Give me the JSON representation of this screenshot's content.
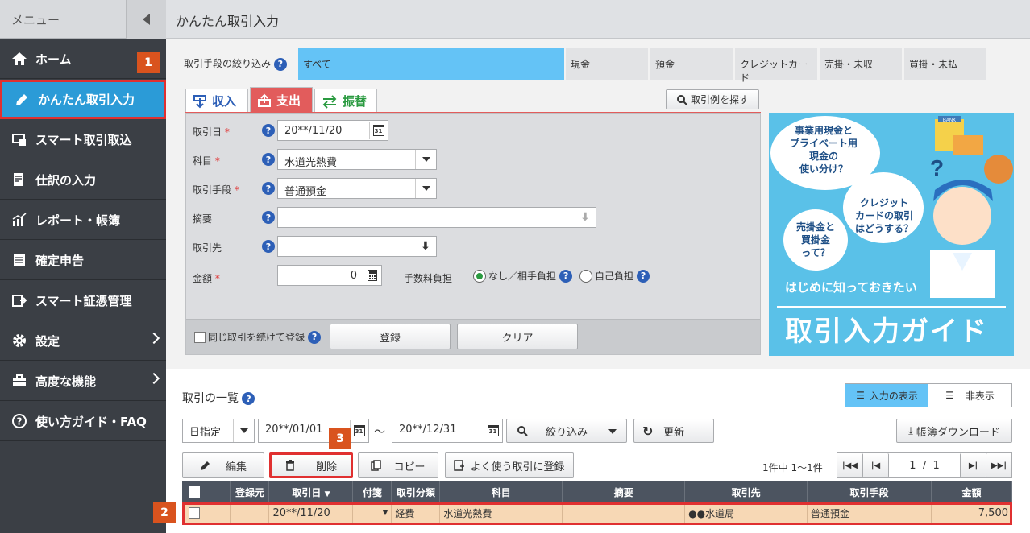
{
  "sidebar": {
    "title": "メニュー",
    "items": [
      {
        "label": "ホーム",
        "icon": "home-icon"
      },
      {
        "label": "かんたん取引入力",
        "icon": "pencil-icon"
      },
      {
        "label": "スマート取引取込",
        "icon": "import-icon"
      },
      {
        "label": "仕訳の入力",
        "icon": "journal-icon"
      },
      {
        "label": "レポート・帳簿",
        "icon": "chart-icon"
      },
      {
        "label": "確定申告",
        "icon": "tax-icon"
      },
      {
        "label": "スマート証憑管理",
        "icon": "receipt-icon"
      },
      {
        "label": "設定",
        "icon": "gear-icon"
      },
      {
        "label": "高度な機能",
        "icon": "toolbox-icon"
      },
      {
        "label": "使い方ガイド・FAQ",
        "icon": "help-icon"
      }
    ]
  },
  "header": {
    "title": "かんたん取引入力"
  },
  "badges": {
    "b1": "1",
    "b2": "2",
    "b3": "3"
  },
  "filter": {
    "label": "取引手段の絞り込み",
    "tabs": [
      "すべて",
      "現金",
      "預金",
      "クレジットカード",
      "売掛・未収",
      "買掛・未払"
    ]
  },
  "type_tabs": {
    "income": "収入",
    "expense": "支出",
    "transfer": "振替"
  },
  "search_example": "取引例を探す",
  "form": {
    "date_label": "取引日",
    "date_value": "20**/11/20",
    "account_label": "科目",
    "account_value": "水道光熱費",
    "method_label": "取引手段",
    "method_value": "普通預金",
    "memo_label": "摘要",
    "partner_label": "取引先",
    "amount_label": "金額",
    "amount_value": "0",
    "fee_label": "手数料負担",
    "fee_none": "なし／相手負担",
    "fee_self": "自己負担",
    "repeat_label": "同じ取引を続けて登録",
    "register": "登録",
    "clear": "クリア"
  },
  "ad": {
    "bubble1": "事業用現金と\nプライベート用\n現金の\n使い分け？",
    "bubble2": "クレジット\nカードの取引\nはどうする？",
    "bubble3": "売掛金と\n買掛金\nって？",
    "sub": "はじめに知っておきたい",
    "main": "取引入力ガイド",
    "bank": "BANK"
  },
  "list": {
    "title": "取引の一覧",
    "show_input": "入力の表示",
    "hide": "非表示",
    "period_mode": "日指定",
    "from": "20**/01/01",
    "tilde": "～",
    "to": "20**/12/31",
    "filter_btn": "絞り込み",
    "refresh": "更新",
    "download": "帳簿ダウンロード",
    "edit": "編集",
    "delete": "削除",
    "copy": "コピー",
    "favorite": "よく使う取引に登録",
    "count": "1件中 1～1件",
    "page_cur": "1",
    "page_sep": "/",
    "page_total": "1",
    "columns": [
      "登録元",
      "取引日",
      "付箋",
      "取引分類",
      "科目",
      "摘要",
      "取引先",
      "取引手段",
      "金額"
    ],
    "rows": [
      {
        "source": "",
        "date": "20**/11/20",
        "tag": "",
        "category": "経費",
        "account": "水道光熱費",
        "memo": "",
        "partner": "●●水道局",
        "method": "普通預金",
        "amount": "7,500"
      }
    ]
  },
  "colors": {
    "accent": "#2b9bd7",
    "expense": "#e25c5c",
    "highlight": "#e03030",
    "filter_selected": "#64c3f6"
  }
}
